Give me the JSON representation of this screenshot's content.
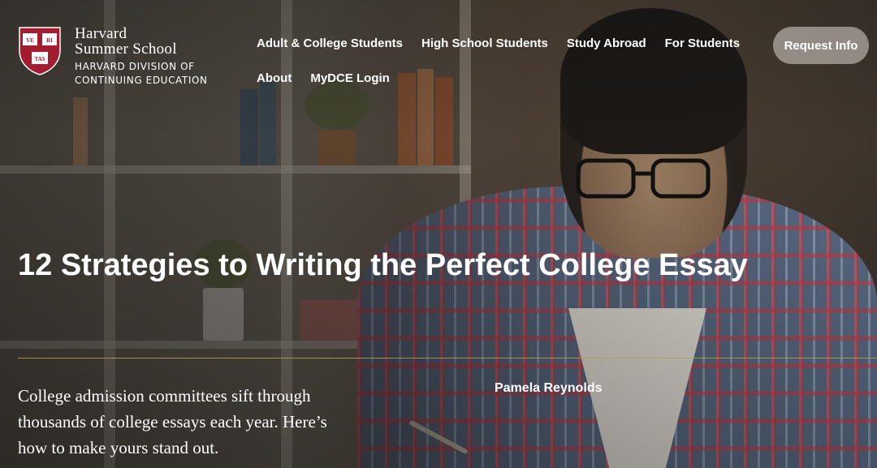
{
  "brand": {
    "name_line1": "Harvard",
    "name_line2": "Summer School",
    "division_line1": "HARVARD DIVISION OF",
    "division_line2": "CONTINUING EDUCATION",
    "shield_color": "#a41c30",
    "shield_text": [
      "VE",
      "RI",
      "TAS"
    ]
  },
  "nav": {
    "row1": [
      "Adult & College Students",
      "High School Students",
      "Study Abroad",
      "For Students"
    ],
    "row2": [
      "About",
      "MyDCE Login"
    ]
  },
  "cta": {
    "label": "Request Info"
  },
  "article": {
    "title": "12 Strategies to Writing the Perfect College Essay",
    "lede": "College admission committees sift through thousands of college essays each year. Here’s how to make yours stand out.",
    "author": "Pamela Reynolds"
  },
  "colors": {
    "divider": "#b79c58",
    "overlay_text": "#ffffff"
  }
}
